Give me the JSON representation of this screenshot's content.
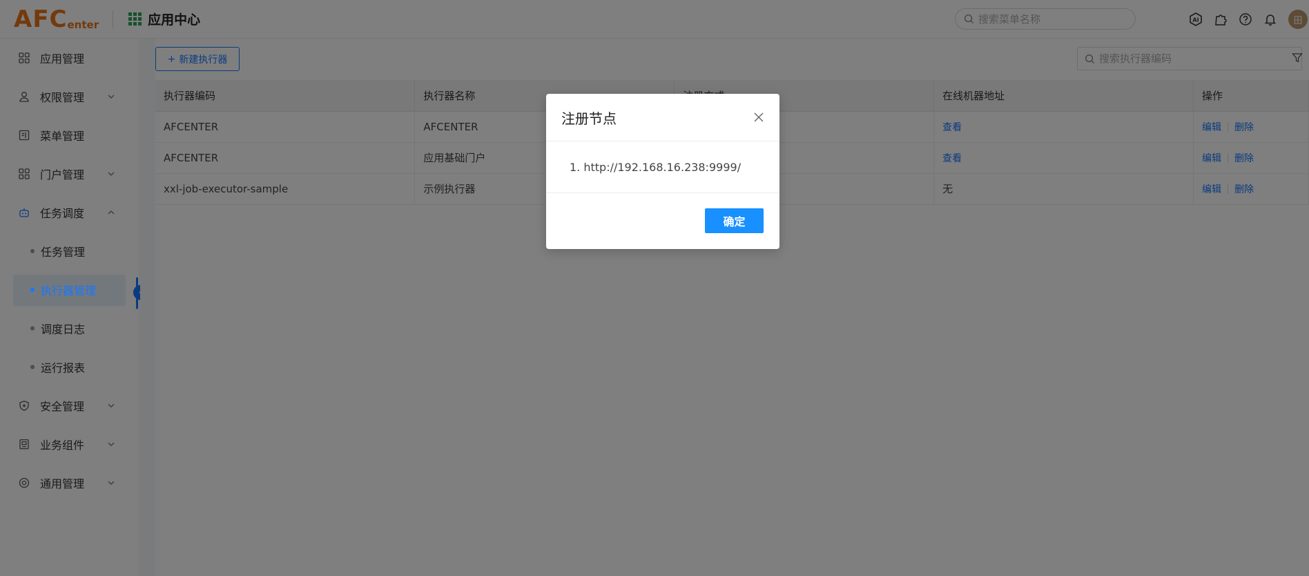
{
  "header": {
    "logo_big": "AFC",
    "logo_small": "enter",
    "app_center_label": "应用中心",
    "menu_search_placeholder": "搜索菜单名称",
    "avatar_text": "田",
    "icons": [
      "ai-icon",
      "plugin-icon",
      "help-icon",
      "bell-icon"
    ]
  },
  "sidebar": {
    "items": [
      {
        "label": "应用管理",
        "icon": "apps-icon",
        "has_children": false
      },
      {
        "label": "权限管理",
        "icon": "user-icon",
        "has_children": true
      },
      {
        "label": "菜单管理",
        "icon": "menu-icon",
        "has_children": false
      },
      {
        "label": "门户管理",
        "icon": "portal-icon",
        "has_children": true
      },
      {
        "label": "任务调度",
        "icon": "robot-icon",
        "has_children": true,
        "expanded": true,
        "children": [
          {
            "label": "任务管理",
            "active": false
          },
          {
            "label": "执行器管理",
            "active": true
          },
          {
            "label": "调度日志",
            "active": false
          },
          {
            "label": "运行报表",
            "active": false
          }
        ]
      },
      {
        "label": "安全管理",
        "icon": "shield-icon",
        "has_children": true
      },
      {
        "label": "业务组件",
        "icon": "component-icon",
        "has_children": true
      },
      {
        "label": "通用管理",
        "icon": "settings-icon",
        "has_children": true
      }
    ]
  },
  "toolbar": {
    "new_button_label": "新建执行器",
    "search_placeholder": "搜索执行器编码"
  },
  "table": {
    "columns": [
      "执行器编码",
      "执行器名称",
      "注册方式",
      "在线机器地址",
      "操作"
    ],
    "rows": [
      {
        "code": "AFCENTER",
        "name": "AFCENTER",
        "reg": "",
        "address": "查看",
        "edit": "编辑",
        "delete": "删除"
      },
      {
        "code": "AFCENTER",
        "name": "应用基础门户",
        "reg": "",
        "address": "查看",
        "edit": "编辑",
        "delete": "删除"
      },
      {
        "code": "xxl-job-executor-sample",
        "name": "示例执行器",
        "reg": "",
        "address": "无",
        "edit": "编辑",
        "delete": "删除"
      }
    ]
  },
  "modal": {
    "title": "注册节点",
    "items": [
      "1. http://192.168.16.238:9999/"
    ],
    "ok_label": "确定"
  },
  "colors": {
    "accent": "#1677ff",
    "brand": "#e8731b",
    "ok_button": "#1890ff"
  }
}
